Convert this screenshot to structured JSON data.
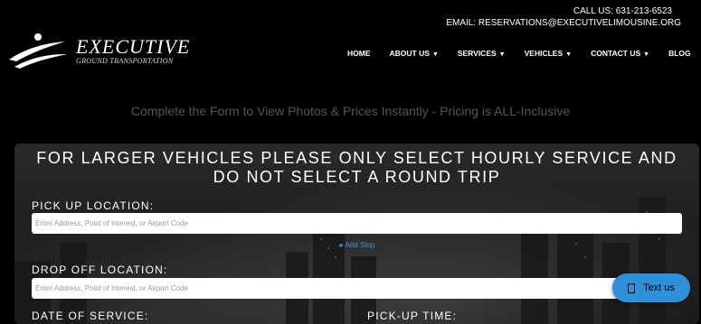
{
  "contact": {
    "phone_line": "CALL US: 631-213-6523",
    "email_line": "EMAIL: RESERVATIONS@EXECUTIVELIMOUSINE.ORG"
  },
  "logo": {
    "title": "EXECUTIVE",
    "subtitle": "GROUND TRANSPORTATION"
  },
  "nav": [
    {
      "label": "HOME",
      "dropdown": false
    },
    {
      "label": "ABOUT US",
      "dropdown": true
    },
    {
      "label": "SERVICES",
      "dropdown": true
    },
    {
      "label": "VEHICLES",
      "dropdown": true
    },
    {
      "label": "CONTACT US",
      "dropdown": true
    },
    {
      "label": "BLOG",
      "dropdown": false
    }
  ],
  "tagline": "Complete the Form to View Photos & Prices Instantly - Pricing is ALL-Inclusive",
  "form": {
    "warning_line1": "FOR LARGER VEHICLES PLEASE ONLY SELECT HOURLY SERVICE AND",
    "warning_line2": "DO NOT SELECT A ROUND TRIP",
    "pickup_label": "PICK UP LOCATION:",
    "pickup_placeholder": "Enter Address, Point of Interest, or Airport Code",
    "add_stop": "Add Stop",
    "dropoff_label": "DROP OFF LOCATION:",
    "dropoff_placeholder": "Enter Address, Point of Interest, or Airport Code",
    "date_label": "DATE OF SERVICE:",
    "time_label": "PICK-UP TIME:"
  },
  "text_us": "Text us",
  "colors": {
    "accent_blue": "#2f8fd8",
    "link_blue": "#4a90e2",
    "background": "#000000"
  }
}
